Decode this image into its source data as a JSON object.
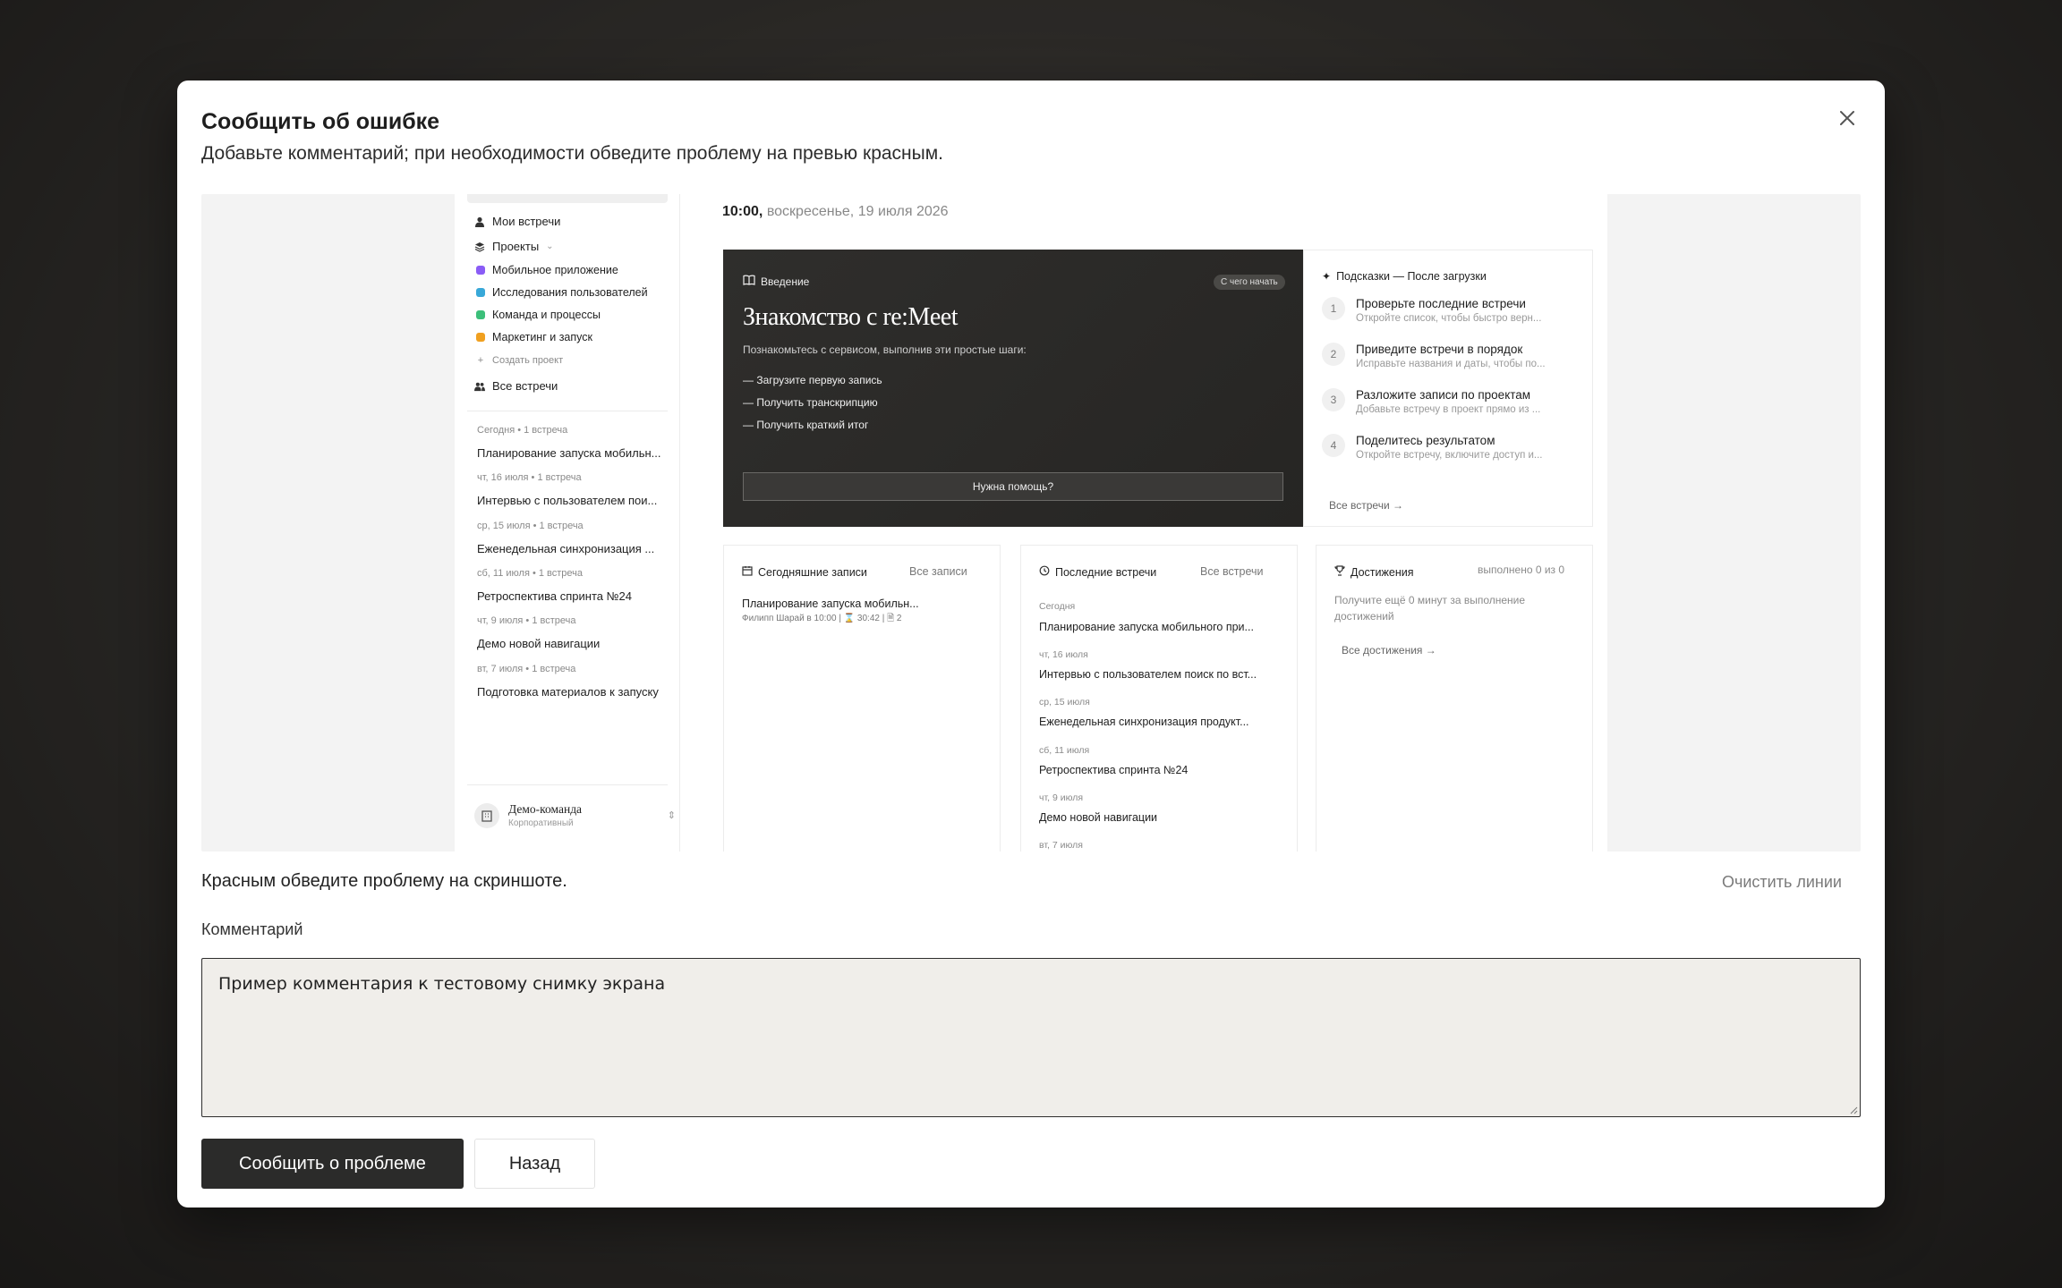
{
  "modal": {
    "title": "Сообщить об ошибке",
    "subtitle": "Добавьте комментарий; при необходимости обведите проблему на превью красным.",
    "hint": "Красным обведите проблему на скриншоте.",
    "clear_lines": "Очистить линии",
    "comment_label": "Комментарий",
    "comment_value": "Пример комментария к тестовому снимку экрана",
    "submit_label": "Сообщить о проблеме",
    "back_label": "Назад"
  },
  "preview": {
    "sidebar": {
      "my_meetings": "Мои встречи",
      "projects": "Проекты",
      "project_items": [
        {
          "label": "Мобильное приложение",
          "color": "#8a5cf6"
        },
        {
          "label": "Исследования пользователей",
          "color": "#38a8d8"
        },
        {
          "label": "Команда и процессы",
          "color": "#3cbf7a"
        },
        {
          "label": "Маркетинг и запуск",
          "color": "#f0a020"
        }
      ],
      "create_project": "Создать проект",
      "all_meetings": "Все встречи",
      "recent": [
        {
          "date": "Сегодня • 1 встреча",
          "title": "Планирование запуска мобильн..."
        },
        {
          "date": "чт, 16 июля • 1 встреча",
          "title": "Интервью с пользователем пои..."
        },
        {
          "date": "ср, 15 июля • 1 встреча",
          "title": "Еженедельная синхронизация ..."
        },
        {
          "date": "сб, 11 июля • 1 встреча",
          "title": "Ретроспектива спринта №24"
        },
        {
          "date": "чт, 9 июля • 1 встреча",
          "title": "Демо новой навигации"
        },
        {
          "date": "вт, 7 июля • 1 встреча",
          "title": "Подготовка материалов к запуску"
        }
      ],
      "team_name": "Демо-команда",
      "team_type": "Корпоративный"
    },
    "header": {
      "time": "10:00,",
      "date": " воскресенье, 19 июля 2026"
    },
    "intro": {
      "tag": "Введение",
      "chip": "С чего начать",
      "heading": "Знакомство с re:Meet",
      "text": "Познакомьтесь с сервисом, выполнив эти простые шаги:",
      "steps": [
        "— Загрузите первую запись",
        "— Получить транскрипцию",
        "— Получить краткий итог"
      ],
      "help_button": "Нужна помощь?"
    },
    "tips": {
      "heading": "Подсказки — После загрузки",
      "items": [
        {
          "num": "1",
          "title": "Проверьте последние встречи",
          "desc": "Откройте список, чтобы быстро верн..."
        },
        {
          "num": "2",
          "title": "Приведите встречи в порядок",
          "desc": "Исправьте названия и даты, чтобы по..."
        },
        {
          "num": "3",
          "title": "Разложите записи по проектам",
          "desc": "Добавьте встречу в проект прямо из ..."
        },
        {
          "num": "4",
          "title": "Поделитесь результатом",
          "desc": "Откройте встречу, включите доступ и..."
        }
      ],
      "link": "Все встречи →"
    },
    "today": {
      "heading": "Сегодняшние записи",
      "link": "Все записи",
      "record_title": "Планирование запуска мобильн...",
      "record_meta": "Филипп Шарай в 10:00  |  ⌛ 30:42  |  🗎 2"
    },
    "latest": {
      "heading": "Последние встречи",
      "link": "Все встречи",
      "items": [
        {
          "date": "Сегодня",
          "title": "Планирование запуска мобильного при..."
        },
        {
          "date": "чт, 16 июля",
          "title": "Интервью с пользователем поиск по вст..."
        },
        {
          "date": "ср, 15 июля",
          "title": "Еженедельная синхронизация продукт..."
        },
        {
          "date": "сб, 11 июля",
          "title": "Ретроспектива спринта №24"
        },
        {
          "date": "чт, 9 июля",
          "title": "Демо новой навигации"
        },
        {
          "date": "вт, 7 июля",
          "title": ""
        }
      ]
    },
    "achievements": {
      "heading": "Достижения",
      "count": "выполнено 0 из 0",
      "desc": "Получите ещё 0 минут за выполнение достижений",
      "link": "Все достижения →"
    }
  }
}
